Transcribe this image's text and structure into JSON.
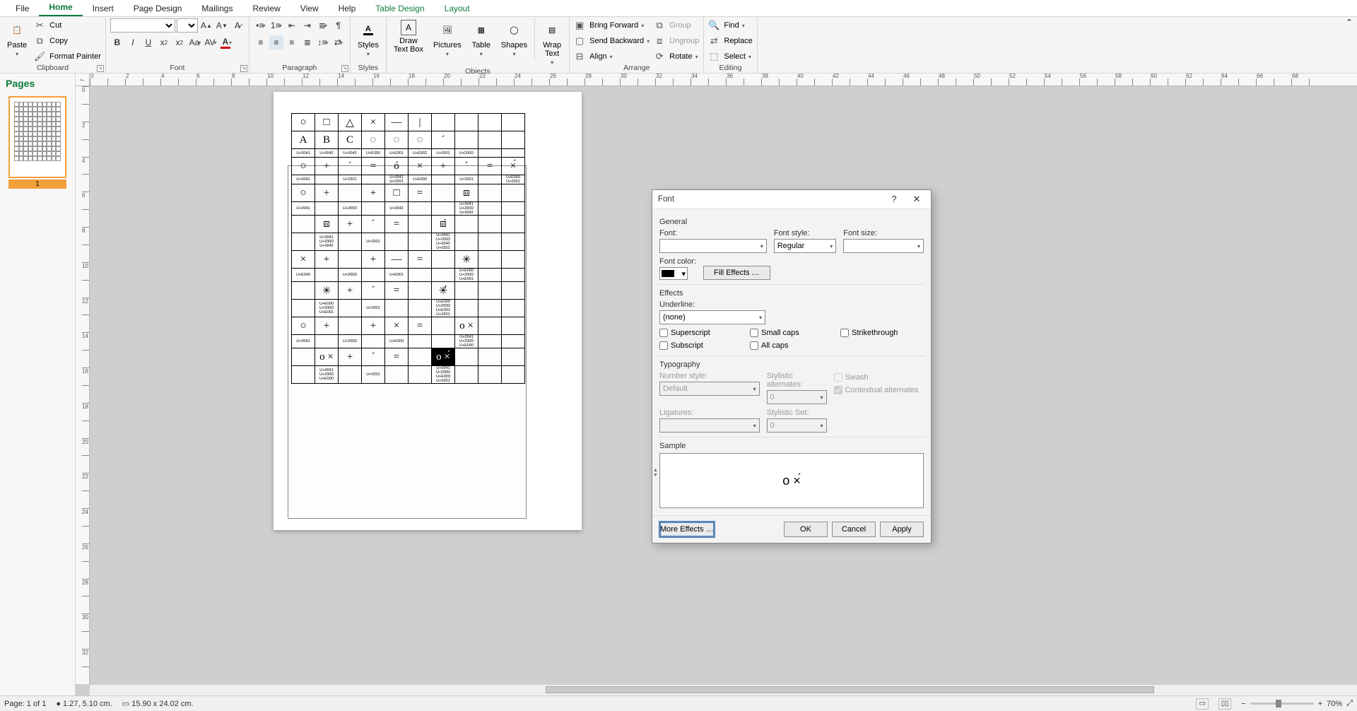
{
  "tabs": {
    "file": "File",
    "home": "Home",
    "insert": "Insert",
    "pagedesign": "Page Design",
    "mailings": "Mailings",
    "review": "Review",
    "view": "View",
    "help": "Help",
    "tabledesign": "Table Design",
    "layout": "Layout"
  },
  "ribbon": {
    "clipboard": {
      "title": "Clipboard",
      "paste": "Paste",
      "cut": "Cut",
      "copy": "Copy",
      "painter": "Format Painter"
    },
    "font": {
      "title": "Font"
    },
    "paragraph": {
      "title": "Paragraph"
    },
    "styles": {
      "title": "Styles",
      "btn": "Styles"
    },
    "objects": {
      "title": "Objects",
      "draw": "Draw\nText Box",
      "pictures": "Pictures",
      "table": "Table",
      "shapes": "Shapes",
      "wrap": "Wrap\nText"
    },
    "arrange": {
      "title": "Arrange",
      "fwd": "Bring Forward",
      "bwd": "Send Backward",
      "align": "Align",
      "group": "Group",
      "ungroup": "Ungroup",
      "rotate": "Rotate"
    },
    "editing": {
      "title": "Editing",
      "find": "Find",
      "replace": "Replace",
      "select": "Select"
    }
  },
  "pages": {
    "title": "Pages",
    "current": "1"
  },
  "dialog": {
    "title": "Font",
    "general": "General",
    "font": "Font:",
    "fontstyle": "Font style:",
    "fontstyleVal": "Regular",
    "fontsize": "Font size:",
    "fontcolor": "Font color:",
    "filleffects": "Fill Effects …",
    "effects": "Effects",
    "underline": "Underline:",
    "underlineVal": "(none)",
    "superscript": "Superscript",
    "subscript": "Subscript",
    "smallcaps": "Small caps",
    "allcaps": "All caps",
    "strike": "Strikethrough",
    "typography": "Typography",
    "numstyle": "Number style:",
    "numstyleVal": "Default",
    "ligatures": "Ligatures:",
    "styalt": "Stylistic alternates:",
    "styaltVal": "0",
    "styset": "Stylistic Set:",
    "stysetVal": "0",
    "swash": "Swash",
    "contextual": "Contextual alternates",
    "sample": "Sample",
    "sampleText": "o ×́",
    "more": "More Effects …",
    "ok": "OK",
    "cancel": "Cancel",
    "apply": "Apply"
  },
  "status": {
    "page": "Page: 1 of 1",
    "pos": "1.27, 5.10 cm.",
    "size": "15.90 x  24.02 cm.",
    "zoom": "70%"
  },
  "table": {
    "r1": [
      "○",
      "□",
      "△",
      "×",
      "—",
      "|",
      "",
      "",
      "",
      ""
    ],
    "r2": [
      "A",
      "B",
      "C",
      "◌",
      "◌",
      "◌",
      "´",
      "",
      "",
      ""
    ],
    "r2c": [
      "U+0041",
      "U+0042",
      "U+0043",
      "U+E000",
      "U+E001",
      "U+E002",
      "U+0301",
      "U+200D",
      "",
      ""
    ],
    "r3": [
      "○",
      "+",
      "´",
      "=",
      "ó",
      "×",
      "+",
      "´",
      "=",
      "×́"
    ],
    "r3c": [
      "U+0041",
      "",
      "U+0301",
      "",
      "U+0041\nU+0301",
      "U+E000",
      "",
      "U+0301",
      "",
      "U+E000\nU+0301"
    ],
    "r4": [
      "○",
      "+",
      "",
      "+",
      "□",
      "=",
      "",
      "⧈",
      "",
      ""
    ],
    "r4c": [
      "U+0041",
      "",
      "U+200D",
      "",
      "U+0042",
      "",
      "",
      "U+0041\nU+200D\nU+0042",
      "",
      ""
    ],
    "r5": [
      "",
      "⧈",
      "+",
      "´",
      "=",
      "",
      "⧈́",
      "",
      "",
      ""
    ],
    "r5c": [
      "",
      "U+0041\nU+200D\nU+0042",
      "",
      "U+0301",
      "",
      "",
      "U+0041\nU+200D\nU+0042\nU+0301",
      "",
      "",
      ""
    ],
    "r6": [
      "×",
      "+",
      "",
      "+",
      "—",
      "=",
      "",
      "✳",
      "",
      ""
    ],
    "r6c": [
      "U+E000",
      "",
      "U+200D",
      "",
      "U+E001",
      "",
      "",
      "U+E000\nU+200D\nU+E001",
      "",
      ""
    ],
    "r7": [
      "",
      "✳",
      "+",
      "´",
      "=",
      "",
      "✳́",
      "",
      "",
      ""
    ],
    "r7c": [
      "",
      "U+E000\nU+200D\nU+E001",
      "",
      "U+0301",
      "",
      "",
      "U+E000\nU+200D\nU+E001\nU+0301",
      "",
      "",
      ""
    ],
    "r8": [
      "○",
      "+",
      "",
      "+",
      "×",
      "=",
      "",
      "o ×",
      "",
      ""
    ],
    "r8c": [
      "U+0041",
      "",
      "U+200D",
      "",
      "U+E000",
      "",
      "",
      "U+0041\nU+200D\nU+E000",
      "",
      ""
    ],
    "r9": [
      "",
      "o ×",
      "+",
      "´",
      "=",
      "",
      "o ×́",
      "",
      "",
      ""
    ],
    "r9c": [
      "",
      "U+0041\nU+200D\nU+E000",
      "",
      "U+0301",
      "",
      "",
      "U+0041\nU+200D\nU+E000\nU+0301",
      "",
      "",
      ""
    ]
  }
}
